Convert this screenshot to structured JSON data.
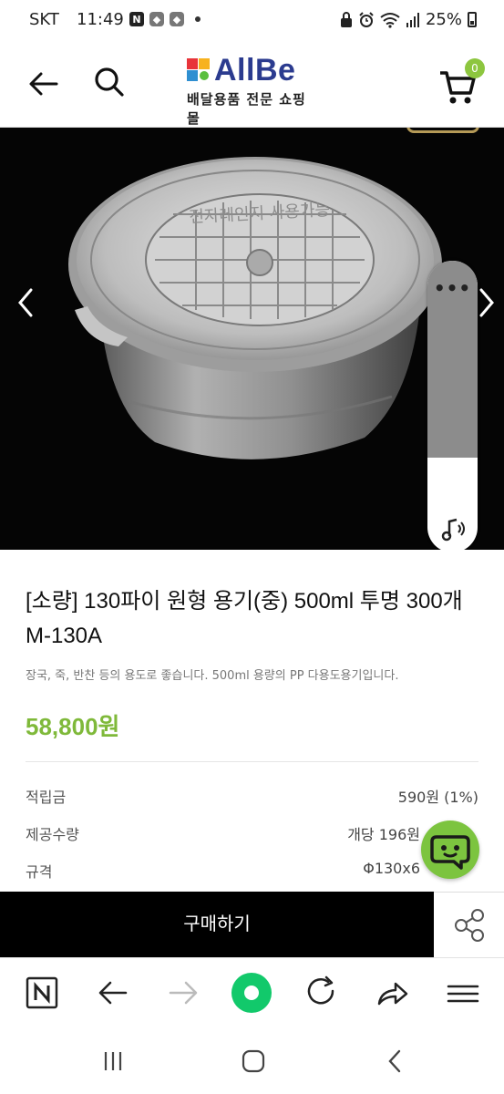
{
  "status_bar": {
    "carrier": "SKT",
    "time": "11:49",
    "notification_icons": [
      "N",
      "app-icon",
      "app-icon"
    ],
    "battery": "25%"
  },
  "header": {
    "logo_name": "AllBe",
    "logo_tagline": "배달용품 전문 쇼핑몰",
    "cart_count": "0"
  },
  "product": {
    "title": "[소량] 130파이 원형 용기(중) 500ml 투명 300개 M-130A",
    "description": "장국, 죽, 반찬 등의 용도로 좋습니다. 500ml 용량의 PP 다용도용기입니다.",
    "price": "58,800원",
    "details": [
      {
        "label": "적립금",
        "value": "590원 (1%)"
      },
      {
        "label": "제공수량",
        "value": "개당 196원"
      },
      {
        "label": "규격",
        "value": "Φ130x6"
      }
    ]
  },
  "image_lid_text": "전자레인지 사용가능",
  "side_panel": {
    "menu": "•••"
  },
  "buy_button_label": "구매하기",
  "colors": {
    "accent_green": "#7fb93a",
    "logo_blue": "#2b3b8f",
    "buy_bar": "#000000",
    "browser_home_green": "#12c96b"
  }
}
